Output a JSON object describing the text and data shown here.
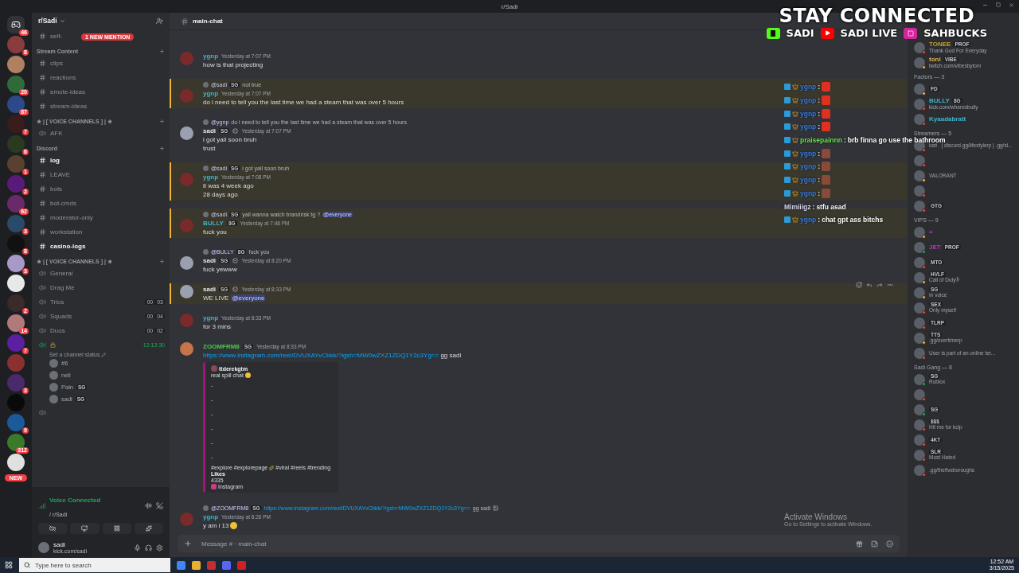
{
  "window": {
    "title": "r/Sadi"
  },
  "servers": [
    {
      "badge": "46",
      "kind": "home",
      "color": "#313338"
    },
    {
      "badge": "8",
      "color": "#8a3b3b"
    },
    {
      "color": "#b08060"
    },
    {
      "badge": "20",
      "color": "#2f6b3a"
    },
    {
      "badge": "87",
      "color": "#2c4a8a"
    },
    {
      "badge": "7",
      "color": "#3a1c1c"
    },
    {
      "badge": "6",
      "color": "#2a3a20"
    },
    {
      "badge": "1",
      "color": "#5a4030"
    },
    {
      "badge": "2",
      "color": "#5a1a7a"
    },
    {
      "badge": "62",
      "color": "#6a2a6a"
    },
    {
      "badge": "3",
      "color": "#2a4a6a"
    },
    {
      "badge": "8",
      "color": "#111111"
    },
    {
      "badge": "3",
      "color": "#a89ac8"
    },
    {
      "color": "#e8e8e8"
    },
    {
      "badge": "2",
      "color": "#3a2a2a"
    },
    {
      "badge": "14",
      "color": "#b07a7a"
    },
    {
      "badge": "7",
      "color": "#5a20a0"
    },
    {
      "color": "#8a3030"
    },
    {
      "badge": "3",
      "color": "#4a2a6a"
    },
    {
      "color": "#0a0a0a"
    },
    {
      "badge": "9",
      "color": "#1a5a9a"
    },
    {
      "badge": "312",
      "color": "#3a7a2a"
    },
    {
      "color": "#e0e0e0"
    }
  ],
  "new_pill": "NEW",
  "sidebar": {
    "server_name": "r/Sadi",
    "mention_pill": "1 NEW MENTION",
    "sections": [
      {
        "kind": "channels",
        "items": [
          {
            "kind": "text",
            "name": "self-",
            "unread": false
          }
        ]
      },
      {
        "kind": "category",
        "name": "Stream Content",
        "items": [
          {
            "kind": "text",
            "name": "clips",
            "unread": false
          },
          {
            "kind": "text",
            "name": "reactions",
            "unread": false
          },
          {
            "kind": "text",
            "name": "emote-ideas",
            "unread": false
          },
          {
            "kind": "text",
            "name": "stream-ideas",
            "unread": false
          }
        ]
      },
      {
        "kind": "category",
        "name": "★ | [ VOICE CHANNELS ] | ★",
        "items": [
          {
            "kind": "voice",
            "name": "AFK",
            "unread": false
          }
        ]
      },
      {
        "kind": "category",
        "name": "Discord",
        "items": [
          {
            "kind": "text",
            "name": "log",
            "unread": true
          },
          {
            "kind": "text",
            "name": "LEAVE",
            "unread": false
          },
          {
            "kind": "text",
            "name": "bots",
            "unread": false
          },
          {
            "kind": "text",
            "name": "bot-cmds",
            "unread": false
          },
          {
            "kind": "text",
            "name": "moderator-only",
            "unread": false
          },
          {
            "kind": "text",
            "name": "workstation",
            "unread": false
          },
          {
            "kind": "text",
            "name": "casino-logs",
            "unread": true
          }
        ]
      },
      {
        "kind": "category",
        "name": "★ | [ VOICE CHANNELS ] | ★",
        "items": [
          {
            "kind": "voice",
            "name": "General",
            "unread": false
          },
          {
            "kind": "voice",
            "name": "Drag Me",
            "unread": false
          },
          {
            "kind": "voice",
            "name": "Trios",
            "unread": false,
            "counts": [
              "00",
              "03"
            ]
          },
          {
            "kind": "voice",
            "name": "Squads",
            "unread": false,
            "counts": [
              "00",
              "04"
            ]
          },
          {
            "kind": "voice",
            "name": "Duos",
            "unread": false,
            "counts": [
              "00",
              "02"
            ]
          },
          {
            "kind": "voice",
            "unread": false,
            "connected": true,
            "timer": "12:13:30",
            "status": "Set a channel status",
            "users": [
              {
                "name": "#6"
              },
              {
                "name": "neli"
              },
              {
                "name": "Pain",
                "tag": "SG"
              },
              {
                "name": "sadi",
                "tag": "SG"
              }
            ]
          },
          {
            "kind": "voice",
            "connected": false
          }
        ]
      }
    ]
  },
  "voice_panel": {
    "title": "Voice Connected",
    "channel": "/ r/Sadi"
  },
  "user_panel": {
    "name": "sadi",
    "status": "kick.com/sadi"
  },
  "chat": {
    "channel": "main-chat",
    "placeholder": "Message # · main-chat",
    "messages": [
      {
        "author": "ygnp",
        "color": "#3fb5c9",
        "time": "Yesterday at 7:07 PM",
        "lines": [
          "how is that projecting"
        ],
        "highlighted": false
      },
      {
        "reply": {
          "author": "@sadi",
          "tag": "SG",
          "text": "not true"
        },
        "author": "ygnp",
        "color": "#3fb5c9",
        "time": "Yesterday at 7:07 PM",
        "lines": [
          "do i need to tell you the last time we had a steam that was over 5 hours"
        ],
        "highlighted": true
      },
      {
        "reply": {
          "author": "@ygnp",
          "text": "do i need to tell you the last time we had a steam that was over 5 hours"
        },
        "author": "sadi",
        "tag": "SG",
        "verified": true,
        "color": "#e6e6e6",
        "time": "Yesterday at 7:07 PM",
        "lines": [
          "i got yall soon bruh",
          "trust"
        ],
        "highlighted": false
      },
      {
        "reply": {
          "author": "@sadi",
          "tag": "SG",
          "text": "i got yall soon bruh"
        },
        "author": "ygnp",
        "color": "#3fb5c9",
        "time": "Yesterday at 7:08 PM",
        "lines": [
          "it was 4 week ago",
          "28 days ago"
        ],
        "highlighted": true
      },
      {
        "reply": {
          "author": "@sadi",
          "tag": "SG",
          "text": "yall wanna watch brandrisk tg ?",
          "mention": "@everyone"
        },
        "author": "BULLY",
        "tag": "8G",
        "color": "#3fb5c9",
        "time": "Yesterday at 7:48 PM",
        "lines": [
          "fuck you"
        ],
        "highlighted": true
      },
      {
        "reply": {
          "author": "@BULLY",
          "tag": "8G",
          "text": "fuck you"
        },
        "author": "sadi",
        "tag": "SG",
        "verified": true,
        "color": "#e6e6e6",
        "time": "Yesterday at 8:20 PM",
        "lines": [
          "fuck yewww"
        ],
        "highlighted": false
      },
      {
        "author": "sadi",
        "tag": "SG",
        "verified": true,
        "color": "#e6e6e6",
        "time": "Yesterday at 8:33 PM",
        "lines": [
          "WE LIVE"
        ],
        "mention": "@everyone",
        "highlighted": true
      },
      {
        "author": "ygnp",
        "color": "#3fb5c9",
        "time": "Yesterday at 8:33 PM",
        "lines": [
          "for 3 mins"
        ],
        "highlighted": false
      },
      {
        "author": "ZOOMFRM8",
        "tag": "SG",
        "color": "#4cc94c",
        "time": "Yesterday at 8:33 PM",
        "link": "https://www.instagram.com/reel/DVUXAYvCbkk/?igsh=MW0wZXZ1ZDQ1Y2c3Yg==",
        "after_link": "gg sadi",
        "highlighted": false,
        "embed": {
          "author": "ttderekgtm",
          "description": "real spill chat",
          "dashes": [
            "-",
            "-",
            "-",
            "-",
            "-",
            "-"
          ],
          "hashtags_a": "#explore #explorepage",
          "hashtags_b": "#viral #reels #trending",
          "field_name": "Likes",
          "field_value": "4335",
          "footer": "Instagram"
        }
      },
      {
        "reply": {
          "author": "@ZOOMFRM8",
          "tag": "SG",
          "link": "https://www.instagram.com/reel/DVUXAYvCbkk/?igsh=MW0wZXZ1ZDQ1Y2c3Yg==",
          "text": "gg sadi"
        },
        "author": "ygnp",
        "color": "#3fb5c9",
        "time": "Yesterday at 8:26 PM",
        "lines": [
          "y am i 13"
        ],
        "cry": true,
        "highlighted": false
      }
    ]
  },
  "overlay": {
    "headline": "STAY CONNECTED",
    "socials": [
      {
        "kind": "kick",
        "label": "SADI"
      },
      {
        "kind": "youtube",
        "label": "SADI LIVE"
      },
      {
        "kind": "instagram",
        "label": "SAHBUCKS"
      }
    ],
    "chat": [
      {
        "user": "ygnp",
        "sep": ":",
        "color": "#3a7fe0",
        "kind": "fries"
      },
      {
        "user": "ygnp",
        "sep": ":",
        "color": "#3a7fe0",
        "kind": "fries"
      },
      {
        "user": "ygnp",
        "sep": ":",
        "color": "#3a7fe0",
        "kind": "fries"
      },
      {
        "user": "ygnp",
        "sep": ":",
        "color": "#3a7fe0",
        "kind": "fries"
      },
      {
        "user": "praisepainnn",
        "sep": ":",
        "color": "#6ee05a",
        "kind": "text",
        "text": "brb finna go use the bathroom"
      },
      {
        "user": "ygnp",
        "sep": ":",
        "color": "#3a7fe0",
        "kind": "face"
      },
      {
        "user": "ygnp",
        "sep": ":",
        "color": "#3a7fe0",
        "kind": "face"
      },
      {
        "user": "ygnp",
        "sep": ":",
        "color": "#3a7fe0",
        "kind": "face"
      },
      {
        "user": "ygnp",
        "sep": ":",
        "color": "#3a7fe0",
        "kind": "face"
      },
      {
        "user": "Mimiiigz",
        "sep": ":",
        "color": "#d8d8f0",
        "kind": "plain",
        "text": "stfu asad"
      },
      {
        "user": "ygnp",
        "sep": ":",
        "color": "#3a7fe0",
        "kind": "text",
        "text": "chat gpt ass bitchs"
      }
    ]
  },
  "members": [
    {
      "kind": "member",
      "name": "TONEE",
      "color": "#c8a030",
      "tag": "PROF",
      "status_text": "Thank God For Everyday",
      "dnd": true,
      "idle": false
    },
    {
      "kind": "member",
      "name": "toni",
      "color": "#e0b040",
      "tag": "VIBE",
      "status_text": "twitch.com/vibesbytoni",
      "dnd": false,
      "idle": true
    },
    {
      "kind": "heading",
      "name": "Factors — 3"
    },
    {
      "kind": "member",
      "tag": "FD",
      "dnd": false,
      "idle": true
    },
    {
      "kind": "member",
      "name": "BULLY",
      "color": "#3fb5c9",
      "tag": "8G",
      "status_text": "kick.com/wheresbully",
      "dnd": true,
      "idle": false
    },
    {
      "kind": "member",
      "name": "Kyaadabratt",
      "color": "#3fb5c9",
      "dnd": true,
      "idle": false
    },
    {
      "kind": "heading",
      "name": "Streamers — 5"
    },
    {
      "kind": "member",
      "status_text": "lost . | discord.gg/lifestylerp | .gg/sl...",
      "dnd": true,
      "idle": false
    },
    {
      "kind": "member",
      "dnd": true,
      "idle": false
    },
    {
      "kind": "member",
      "status_text": "VALORANT",
      "dnd": false,
      "idle": true
    },
    {
      "kind": "member",
      "dnd": true,
      "idle": false
    },
    {
      "kind": "member",
      "tag": "GTG",
      "dnd": true,
      "idle": false
    },
    {
      "kind": "heading",
      "name": "VIPS — 9"
    },
    {
      "kind": "member",
      "name": "=",
      "color": "#c030c0",
      "dnd": false,
      "idle": true
    },
    {
      "kind": "member",
      "name": "JET",
      "color": "#c030c0",
      "tag": "PROF",
      "dnd": false,
      "idle": false
    },
    {
      "kind": "member",
      "tag": "MTO",
      "dnd": true,
      "idle": false
    },
    {
      "kind": "member",
      "tag": "HVLF",
      "status_text": "Call of Duty®",
      "dnd": false,
      "idle": true
    },
    {
      "kind": "member",
      "tag": "SG",
      "status_text": "In voice",
      "dnd": false,
      "idle": true
    },
    {
      "kind": "member",
      "tag": "SEX",
      "status_text": "Only myself",
      "dnd": true,
      "idle": false
    },
    {
      "kind": "member",
      "tag": "TLRP",
      "dnd": true,
      "idle": false
    },
    {
      "kind": "member",
      "tag": "TTS",
      "status_text": ".gg/overtimerp",
      "dnd": false,
      "idle": true
    },
    {
      "kind": "member",
      "status_text": "User is part of an online ter...",
      "dnd": true,
      "idle": false
    },
    {
      "kind": "heading",
      "name": "Sadi Gang — 8"
    },
    {
      "kind": "member",
      "tag": "SG",
      "status_text": "Roblox",
      "dnd": false,
      "idle": false
    },
    {
      "kind": "member",
      "dnd": true,
      "idle": false
    },
    {
      "kind": "member",
      "tag": "SG",
      "dnd": false,
      "idle": false
    },
    {
      "kind": "member",
      "tag": "$$$",
      "status_text": "Hit me for kcip",
      "dnd": true,
      "idle": false
    },
    {
      "kind": "member",
      "tag": "4KT",
      "dnd": true,
      "idle": false
    },
    {
      "kind": "member",
      "tag": "SLR",
      "status_text": "Most Hated",
      "dnd": true,
      "idle": false
    },
    {
      "kind": "member",
      "status_text": ".gg/thefiveboroughs",
      "dnd": true,
      "idle": false
    }
  ],
  "activation": {
    "title": "Activate Windows",
    "text": "Go to Settings to activate Windows."
  },
  "taskbar": {
    "search_placeholder": "Type here to search",
    "time": "12:52 AM",
    "date": "3/15/2025"
  }
}
